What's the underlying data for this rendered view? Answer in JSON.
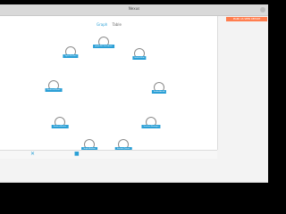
{
  "window": {
    "title": "Nexus"
  },
  "viewtabs": {
    "graph": "Graph",
    "table": "Table"
  },
  "nodes": [
    {
      "label": "graphNet-backbone"
    },
    {
      "label": "Topic-Fetcher"
    },
    {
      "label": "Router-Hub"
    },
    {
      "label": "Retrieval-Store"
    },
    {
      "label": "Embedder-A"
    },
    {
      "label": "Ranker-Worker"
    },
    {
      "label": "Session-Manager"
    },
    {
      "label": "Graph-Builder"
    },
    {
      "label": "Stream-Queue"
    },
    {
      "label": "Cache-Node"
    }
  ],
  "toolbar": {
    "close_icon": "close-icon",
    "bookmark_icon": "bookmark-icon"
  },
  "badge": {
    "text": "MARK AS SEEN REPORT"
  },
  "colors": {
    "accent": "#2a9fd6",
    "badge": "#ff7e4f"
  }
}
